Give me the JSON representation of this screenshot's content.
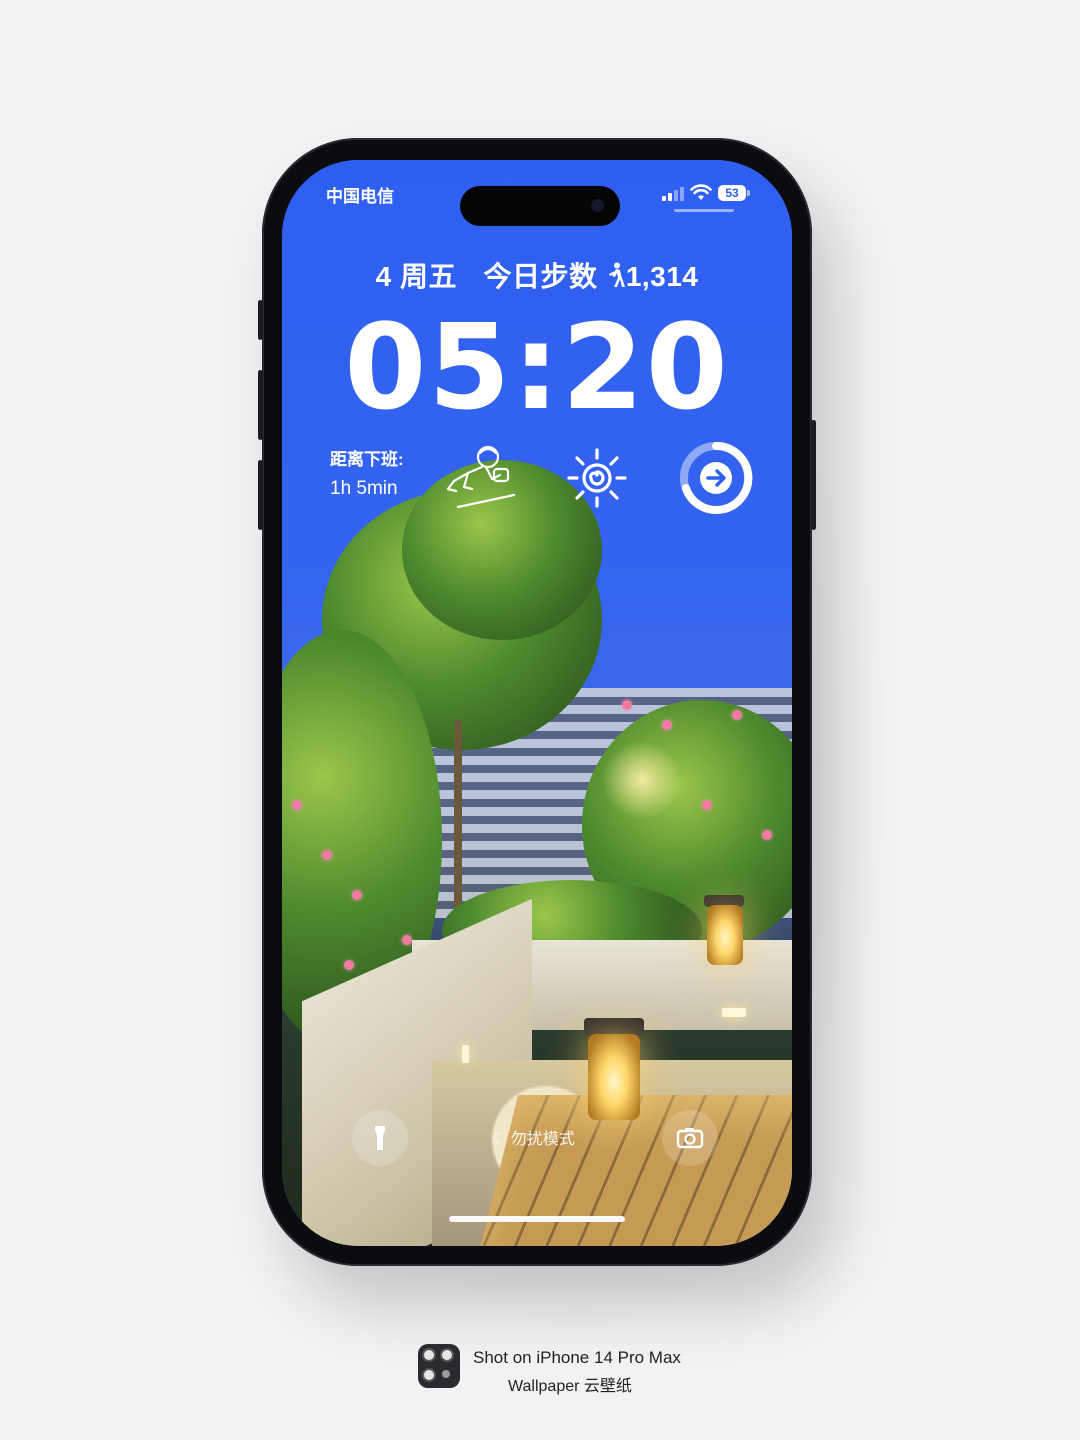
{
  "status_bar": {
    "carrier": "中国电信",
    "battery": "53",
    "icons": [
      "signal-icon",
      "wifi-icon",
      "battery-icon"
    ]
  },
  "lock_screen": {
    "date_weekday": "4 周五",
    "steps_label": "今日步数",
    "steps_value": "1,314",
    "time": "05:20",
    "offwork_label": "距离下班:",
    "offwork_value": "1h 5min",
    "widget_icons": [
      "crawling-figure-icon",
      "sun-icon",
      "progress-ring-arrow-icon"
    ],
    "focus_mode": "勿扰模式",
    "controls": [
      "flashlight-icon",
      "camera-icon"
    ]
  },
  "watermark": {
    "line1": "Shot on iPhone 14 Pro Max",
    "line2": "Wallpaper 云壁纸"
  },
  "colors": {
    "sky": "#2f5ff0",
    "phone_frame": "#0c0c10",
    "page_bg": "#f1f2f4"
  }
}
